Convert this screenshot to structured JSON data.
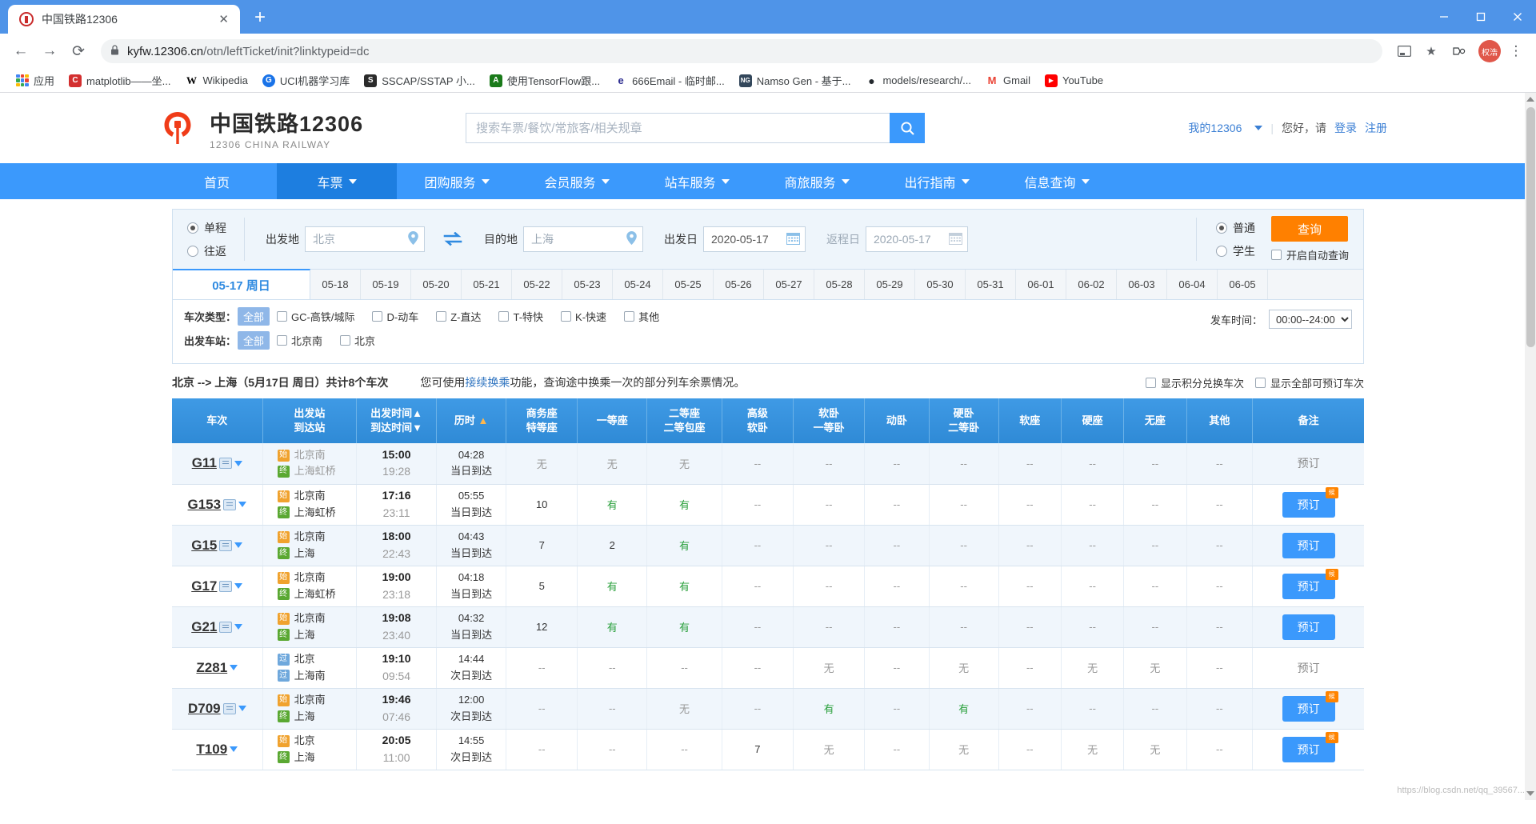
{
  "browser": {
    "tab": {
      "title": "中国铁路12306",
      "favicon": "railway-logo-icon",
      "close": "✕"
    },
    "newtab_label": "+",
    "window": {
      "minimize": "minimize-icon",
      "maximize": "maximize-icon",
      "close": "close-icon"
    },
    "nav": {
      "back": "←",
      "forward": "→",
      "reload": "⟳"
    },
    "omnibox": {
      "lock": "lock-icon",
      "url_prefix": "kyfw.12306.cn",
      "url_rest": "/otn/leftTicket/init?linktypeid=dc",
      "cast": "cast-icon",
      "star": "★"
    },
    "profile_initial": "权浩",
    "menu": "⋮",
    "bookmarks": [
      {
        "label": "应用",
        "icon": "apps-grid-icon",
        "color": "#4285f4"
      },
      {
        "label": "matplotlib——坐...",
        "icon": "matplotlib-icon",
        "color": "#d32f2f"
      },
      {
        "label": "Wikipedia",
        "icon": "wikipedia-icon",
        "color": "#ffffff"
      },
      {
        "label": "UCI机器学习库",
        "icon": "uci-icon",
        "color": "#1a73e8"
      },
      {
        "label": "SSCAP/SSTAP 小...",
        "icon": "sscap-icon",
        "color": "#2b2b2b"
      },
      {
        "label": "使用TensorFlow跟...",
        "icon": "tensorflow-icon",
        "color": "#1a7a1a"
      },
      {
        "label": "666Email - 临时邮...",
        "icon": "email-icon",
        "color": "#2b2b8f"
      },
      {
        "label": "Namso Gen - 基于...",
        "icon": "namso-icon",
        "color": "#33475b"
      },
      {
        "label": "models/research/...",
        "icon": "github-icon",
        "color": "#24292e"
      },
      {
        "label": "Gmail",
        "icon": "gmail-icon",
        "color": "#ea4335"
      },
      {
        "label": "YouTube",
        "icon": "youtube-icon",
        "color": "#ff0000"
      }
    ]
  },
  "site": {
    "logo": {
      "cn": "中国铁路12306",
      "en": "12306 CHINA RAILWAY",
      "icon": "railway-logo-icon",
      "color": "#f03c18"
    },
    "search": {
      "placeholder": "搜索车票/餐饮/常旅客/相关规章",
      "value": "",
      "button_icon": "search-icon"
    },
    "user": {
      "my12306": "我的12306",
      "greeting": "您好，请",
      "login": "登录",
      "register": "注册"
    },
    "nav_items": [
      {
        "label": "首页",
        "has_caret": false,
        "active": false
      },
      {
        "label": "车票",
        "has_caret": true,
        "active": true
      },
      {
        "label": "团购服务",
        "has_caret": true,
        "active": false
      },
      {
        "label": "会员服务",
        "has_caret": true,
        "active": false
      },
      {
        "label": "站车服务",
        "has_caret": true,
        "active": false
      },
      {
        "label": "商旅服务",
        "has_caret": true,
        "active": false
      },
      {
        "label": "出行指南",
        "has_caret": true,
        "active": false
      },
      {
        "label": "信息查询",
        "has_caret": true,
        "active": false
      }
    ]
  },
  "query": {
    "trip_types": [
      {
        "label": "单程",
        "selected": true
      },
      {
        "label": "往返",
        "selected": false
      }
    ],
    "from": {
      "label": "出发地",
      "value": "北京",
      "icon": "location-pin-icon"
    },
    "to": {
      "label": "目的地",
      "value": "上海",
      "icon": "location-pin-icon"
    },
    "swap_icon": "swap-arrows-icon",
    "depart_date": {
      "label": "出发日",
      "value": "2020-05-17",
      "icon": "calendar-icon"
    },
    "return_date": {
      "label": "返程日",
      "value": "2020-05-17",
      "icon": "calendar-icon",
      "disabled": true
    },
    "passenger_types": [
      {
        "label": "普通",
        "selected": true
      },
      {
        "label": "学生",
        "selected": false
      }
    ],
    "search_button": "查询",
    "auto_query": {
      "label": "开启自动查询",
      "checked": false
    }
  },
  "date_tabs": [
    {
      "label": "05-17 周日",
      "active": true
    },
    {
      "label": "05-18",
      "active": false
    },
    {
      "label": "05-19",
      "active": false
    },
    {
      "label": "05-20",
      "active": false
    },
    {
      "label": "05-21",
      "active": false
    },
    {
      "label": "05-22",
      "active": false
    },
    {
      "label": "05-23",
      "active": false
    },
    {
      "label": "05-24",
      "active": false
    },
    {
      "label": "05-25",
      "active": false
    },
    {
      "label": "05-26",
      "active": false
    },
    {
      "label": "05-27",
      "active": false
    },
    {
      "label": "05-28",
      "active": false
    },
    {
      "label": "05-29",
      "active": false
    },
    {
      "label": "05-30",
      "active": false
    },
    {
      "label": "05-31",
      "active": false
    },
    {
      "label": "06-01",
      "active": false
    },
    {
      "label": "06-02",
      "active": false
    },
    {
      "label": "06-03",
      "active": false
    },
    {
      "label": "06-04",
      "active": false
    },
    {
      "label": "06-05",
      "active": false
    }
  ],
  "filters": {
    "train_type": {
      "label": "车次类型：",
      "all": "全部",
      "options": [
        {
          "label": "GC-高铁/城际",
          "checked": false
        },
        {
          "label": "D-动车",
          "checked": false
        },
        {
          "label": "Z-直达",
          "checked": false
        },
        {
          "label": "T-特快",
          "checked": false
        },
        {
          "label": "K-快速",
          "checked": false
        },
        {
          "label": "其他",
          "checked": false
        }
      ]
    },
    "departure_station": {
      "label": "出发车站：",
      "all": "全部",
      "options": [
        {
          "label": "北京南",
          "checked": false
        },
        {
          "label": "北京",
          "checked": false
        }
      ]
    },
    "departure_time": {
      "label": "发车时间：",
      "value": "00:00--24:00"
    }
  },
  "info": {
    "route": "北京 --> 上海（5月17日 周日）共计8个车次",
    "tip_before": "您可使用",
    "tip_link": "接续换乘",
    "tip_after": "功能，查询途中换乘一次的部分列车余票情况。",
    "show_points": {
      "label": "显示积分兑换车次",
      "checked": false
    },
    "show_all": {
      "label": "显示全部可预订车次",
      "checked": false
    }
  },
  "table": {
    "headers": [
      {
        "line1": "车次",
        "line2": ""
      },
      {
        "line1": "出发站",
        "line2": "到达站"
      },
      {
        "line1": "出发时间▲",
        "line2": "到达时间▼"
      },
      {
        "line1": "历时",
        "line2": "",
        "sort": "▲"
      },
      {
        "line1": "商务座",
        "line2": "特等座"
      },
      {
        "line1": "一等座",
        "line2": ""
      },
      {
        "line1": "二等座",
        "line2": "二等包座"
      },
      {
        "line1": "高级",
        "line2": "软卧"
      },
      {
        "line1": "软卧",
        "line2": "一等卧"
      },
      {
        "line1": "动卧",
        "line2": ""
      },
      {
        "line1": "硬卧",
        "line2": "二等卧"
      },
      {
        "line1": "软座",
        "line2": ""
      },
      {
        "line1": "硬座",
        "line2": ""
      },
      {
        "line1": "无座",
        "line2": ""
      },
      {
        "line1": "其他",
        "line2": ""
      },
      {
        "line1": "备注",
        "line2": ""
      }
    ],
    "rows": [
      {
        "train_no": "G11",
        "has_badge": true,
        "disabled": true,
        "from_station": "北京南",
        "from_mark": "始",
        "to_station": "上海虹桥",
        "to_mark": "终",
        "depart": "15:00",
        "arrive": "19:28",
        "duration": "04:28",
        "arrive_day": "当日到达",
        "seats": [
          "无",
          "无",
          "无",
          "--",
          "--",
          "--",
          "--",
          "--",
          "--",
          "--",
          "--"
        ],
        "action": "预订",
        "action_type": "plain",
        "flag": false
      },
      {
        "train_no": "G153",
        "has_badge": true,
        "disabled": false,
        "from_station": "北京南",
        "from_mark": "始",
        "to_station": "上海虹桥",
        "to_mark": "终",
        "depart": "17:16",
        "arrive": "23:11",
        "duration": "05:55",
        "arrive_day": "当日到达",
        "seats": [
          "10",
          "有",
          "有",
          "--",
          "--",
          "--",
          "--",
          "--",
          "--",
          "--",
          "--"
        ],
        "action": "预订",
        "action_type": "button",
        "flag": true
      },
      {
        "train_no": "G15",
        "has_badge": true,
        "disabled": false,
        "from_station": "北京南",
        "from_mark": "始",
        "to_station": "上海",
        "to_mark": "终",
        "depart": "18:00",
        "arrive": "22:43",
        "duration": "04:43",
        "arrive_day": "当日到达",
        "seats": [
          "7",
          "2",
          "有",
          "--",
          "--",
          "--",
          "--",
          "--",
          "--",
          "--",
          "--"
        ],
        "action": "预订",
        "action_type": "button",
        "flag": false
      },
      {
        "train_no": "G17",
        "has_badge": true,
        "disabled": false,
        "from_station": "北京南",
        "from_mark": "始",
        "to_station": "上海虹桥",
        "to_mark": "终",
        "depart": "19:00",
        "arrive": "23:18",
        "duration": "04:18",
        "arrive_day": "当日到达",
        "seats": [
          "5",
          "有",
          "有",
          "--",
          "--",
          "--",
          "--",
          "--",
          "--",
          "--",
          "--"
        ],
        "action": "预订",
        "action_type": "button",
        "flag": true
      },
      {
        "train_no": "G21",
        "has_badge": true,
        "disabled": false,
        "from_station": "北京南",
        "from_mark": "始",
        "to_station": "上海",
        "to_mark": "终",
        "depart": "19:08",
        "arrive": "23:40",
        "duration": "04:32",
        "arrive_day": "当日到达",
        "seats": [
          "12",
          "有",
          "有",
          "--",
          "--",
          "--",
          "--",
          "--",
          "--",
          "--",
          "--"
        ],
        "action": "预订",
        "action_type": "button",
        "flag": false
      },
      {
        "train_no": "Z281",
        "has_badge": false,
        "disabled": false,
        "from_station": "北京",
        "from_mark": "过",
        "to_station": "上海南",
        "to_mark": "过",
        "depart": "19:10",
        "arrive": "09:54",
        "duration": "14:44",
        "arrive_day": "次日到达",
        "seats": [
          "--",
          "--",
          "--",
          "--",
          "无",
          "--",
          "无",
          "--",
          "无",
          "无",
          "--"
        ],
        "action": "预订",
        "action_type": "plain",
        "flag": false
      },
      {
        "train_no": "D709",
        "has_badge": true,
        "disabled": false,
        "from_station": "北京南",
        "from_mark": "始",
        "to_station": "上海",
        "to_mark": "终",
        "depart": "19:46",
        "arrive": "07:46",
        "duration": "12:00",
        "arrive_day": "次日到达",
        "seats": [
          "--",
          "--",
          "无",
          "--",
          "有",
          "--",
          "有",
          "--",
          "--",
          "--",
          "--"
        ],
        "action": "预订",
        "action_type": "button",
        "flag": true
      },
      {
        "train_no": "T109",
        "has_badge": false,
        "disabled": false,
        "from_station": "北京",
        "from_mark": "始",
        "to_station": "上海",
        "to_mark": "终",
        "depart": "20:05",
        "arrive": "11:00",
        "duration": "14:55",
        "arrive_day": "次日到达",
        "seats": [
          "--",
          "--",
          "--",
          "7",
          "无",
          "--",
          "无",
          "--",
          "无",
          "无",
          "--"
        ],
        "action": "预订",
        "action_type": "button",
        "flag": true
      }
    ]
  },
  "watermark": "https://blog.csdn.net/qq_39567..."
}
